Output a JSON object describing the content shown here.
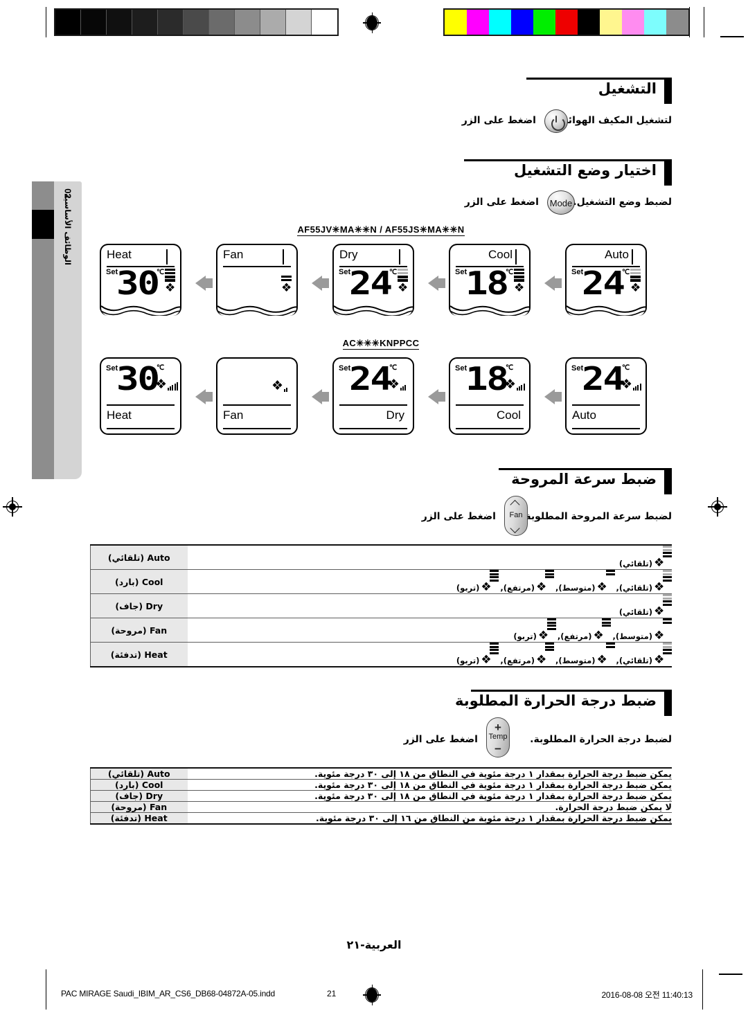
{
  "calibration": {
    "grayscale_steps": [
      "#000000",
      "#070707",
      "#101010",
      "#1d1d1d",
      "#2b2b2b",
      "#4a4a4a",
      "#6b6b6b",
      "#8c8c8c",
      "#ababab",
      "#d4d4d4",
      "#ffffff"
    ],
    "color_steps": [
      "#ffff00",
      "#ff00ff",
      "#00ffff",
      "#0000ff",
      "#00ee00",
      "#ee0000",
      "#000000",
      "#fff68f",
      "#ff8cf0",
      "#7dfdfd",
      "#8c8c8c"
    ]
  },
  "sidebar": {
    "chapter_number": "02",
    "chapter_title": "الوظائف الأساسية"
  },
  "sections": {
    "operation": {
      "heading": "التشغيل",
      "instruction_head": "اضغط على الزر",
      "instruction_tail": "لتشغيل المكيف الهوائي.",
      "button_name": "power-button"
    },
    "mode_select": {
      "heading": "اختيار وضع التشغيل",
      "instruction_head": "اضغط على الزر",
      "instruction_tail": "لضبط وضع التشغيل.",
      "button_label": "Mode"
    },
    "fan_speed": {
      "heading": "ضبط سرعة المروحة",
      "instruction_head": "اضغط على الزر",
      "instruction_tail": "لضبط سرعة المروحة المطلوبة.",
      "button_label": "Fan"
    },
    "temperature": {
      "heading": "ضبط درجة الحرارة المطلوبة",
      "instruction_head": "اضغط على الزر",
      "instruction_tail": "لضبط درجة الحرارة المطلوبة.",
      "button_label": "Temp",
      "plus": "+",
      "minus": "−"
    }
  },
  "display_rows": [
    {
      "model": "AF55JV✳MA✳✳N / AF55JS✳MA✳✳N",
      "label_position": "top",
      "panels": [
        {
          "mode": "Auto",
          "temp": "24",
          "unit": "℃",
          "set": "Set",
          "fan_bars": 4,
          "fan_gray": 2,
          "has_temp": true
        },
        {
          "mode": "Cool",
          "temp": "18",
          "unit": "℃",
          "set": "Set",
          "fan_bars": 4,
          "fan_gray": 0,
          "has_temp": true
        },
        {
          "mode": "Dry",
          "temp": "24",
          "unit": "℃",
          "set": "Set",
          "fan_bars": 4,
          "fan_gray": 2,
          "has_temp": true
        },
        {
          "mode": "Fan",
          "temp": "",
          "unit": "",
          "set": "",
          "fan_bars": 2,
          "fan_gray": 0,
          "has_temp": false
        },
        {
          "mode": "Heat",
          "temp": "30",
          "unit": "℃",
          "set": "Set",
          "fan_bars": 4,
          "fan_gray": 0,
          "has_temp": true
        }
      ]
    },
    {
      "model": "AC✳✳✳KNPPCC",
      "label_position": "bottom",
      "panels": [
        {
          "mode": "Auto",
          "temp": "24",
          "unit": "℃",
          "set": "Set",
          "fan_level": 4,
          "has_temp": true
        },
        {
          "mode": "Cool",
          "temp": "18",
          "unit": "℃",
          "set": "Set",
          "fan_level": 4,
          "has_temp": true
        },
        {
          "mode": "Dry",
          "temp": "24",
          "unit": "℃",
          "set": "Set",
          "fan_level": 3,
          "has_temp": true
        },
        {
          "mode": "Fan",
          "temp": "",
          "unit": "",
          "set": "",
          "fan_level": 2,
          "has_temp": false
        },
        {
          "mode": "Heat",
          "temp": "30",
          "unit": "℃",
          "set": "Set",
          "fan_level": 5,
          "has_temp": true
        }
      ]
    }
  ],
  "fan_speed_table": {
    "rows": [
      {
        "mode": "Auto (تلقائي)",
        "speeds": [
          {
            "caption": "(تلقائي)",
            "bars": 4,
            "gray": 2
          }
        ]
      },
      {
        "mode": "Cool (بارد)",
        "speeds": [
          {
            "caption": "(تلقائي),",
            "bars": 4,
            "gray": 2
          },
          {
            "caption": "(متوسط),",
            "bars": 2,
            "gray": 0
          },
          {
            "caption": "(مرتفع),",
            "bars": 3,
            "gray": 0
          },
          {
            "caption": "(تربو)",
            "bars": 4,
            "gray": 0
          }
        ]
      },
      {
        "mode": "Dry (جاف)",
        "speeds": [
          {
            "caption": "(تلقائي)",
            "bars": 4,
            "gray": 2
          }
        ]
      },
      {
        "mode": "Fan (مروحة)",
        "speeds": [
          {
            "caption": "(متوسط),",
            "bars": 2,
            "gray": 0
          },
          {
            "caption": "(مرتفع),",
            "bars": 3,
            "gray": 0
          },
          {
            "caption": "(تربو)",
            "bars": 4,
            "gray": 0
          }
        ]
      },
      {
        "mode": "Heat (تدفئة)",
        "speeds": [
          {
            "caption": "(تلقائي),",
            "bars": 4,
            "gray": 2
          },
          {
            "caption": "(متوسط),",
            "bars": 2,
            "gray": 0
          },
          {
            "caption": "(مرتفع),",
            "bars": 3,
            "gray": 0
          },
          {
            "caption": "(تربو)",
            "bars": 4,
            "gray": 0
          }
        ]
      }
    ]
  },
  "temperature_table": {
    "rows": [
      {
        "mode": "Auto (تلقائي)",
        "text": "يمكن ضبط درجة الحرارة بمقدار ١ درجة مئوية في النطاق من ١٨ إلى ٣٠ درجة مئوية."
      },
      {
        "mode": "Cool (بارد)",
        "text": "يمكن ضبط درجة الحرارة بمقدار ١ درجة مئوية في النطاق من ١٨ إلى ٣٠ درجة مئوية."
      },
      {
        "mode": "Dry (جاف)",
        "text": "يمكن ضبط درجة الحرارة بمقدار ١ درجة مئوية في النطاق من ١٨ إلى ٣٠ درجة مئوية."
      },
      {
        "mode": "Fan (مروحة)",
        "text": "لا يمكن ضبط درجة الحرارة."
      },
      {
        "mode": "Heat (تدفئة)",
        "text": "يمكن ضبط درجة الحرارة بمقدار ١ درجة مئوية من النطاق من ١٦ إلى ٣٠ درجة مئوية."
      }
    ]
  },
  "page_footer": {
    "page_label": "العربية-٢١",
    "filename": "PAC MIRAGE Saudi_IBIM_AR_CS6_DB68-04872A-05.indd",
    "page_number": "21",
    "timestamp": "2016-08-08   오전 11:40:13"
  }
}
